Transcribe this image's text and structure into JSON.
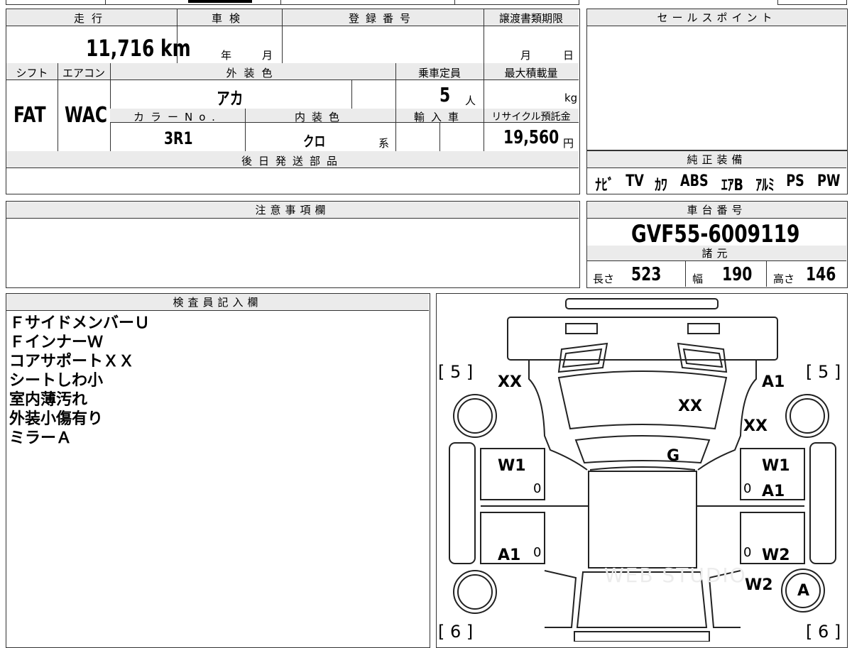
{
  "main_sheet": {
    "mileage_label": "走行",
    "mileage_value": "11,716 km",
    "shaken_label": "車検",
    "shaken_year": "年",
    "shaken_month": "月",
    "reg_label": "登録番号",
    "transfer_label": "譲渡書類期限",
    "transfer_month": "月",
    "transfer_day": "日",
    "shift_label": "シフト",
    "shift_value": "FAT",
    "aircon_label": "エアコン",
    "aircon_value": "WAC",
    "exterior_label": "外装色",
    "exterior_value": "アカ",
    "capacity_label": "乗車定員",
    "capacity_value": "5",
    "capacity_unit": "人",
    "load_label": "最大積載量",
    "load_unit": "kg",
    "color_no_label": "カラーNo.",
    "color_no_value": "3R1",
    "interior_label": "内装色",
    "interior_value": "クロ",
    "interior_suffix": "系",
    "import_label": "輸入車",
    "recycle_label": "リサイクル預託金",
    "recycle_value": "19,560",
    "recycle_unit": "円",
    "later_parts_label": "後日発送部品",
    "caution_label": "注意事項欄",
    "inspector_label": "検査員記入欄"
  },
  "sales_point": {
    "label": "セールスポイント"
  },
  "equipment": {
    "label": "純正装備",
    "items": [
      "ﾅﾋﾞ",
      "TV",
      "ｶﾜ",
      "ABS",
      "ｴｱB",
      "ｱﾙﾐ",
      "PS",
      "PW"
    ]
  },
  "chassis": {
    "label": "車台番号",
    "value": "GVF55-6009119"
  },
  "specs": {
    "label": "諸元",
    "length_label": "長さ",
    "length_value": "523",
    "width_label": "幅",
    "width_value": "190",
    "height_label": "高さ",
    "height_value": "146"
  },
  "inspector_notes": [
    "ＦサイドメンバーＵ",
    "ＦインナーＷ",
    "コアサポートＸＸ",
    "シートしわ小",
    "室内薄汚れ",
    "外装小傷有り",
    "ミラーＡ"
  ],
  "diagram": {
    "tire_fl": "5",
    "tire_fr": "5",
    "tire_rl": "6",
    "tire_rr": "6",
    "marks": {
      "front_left": "XX",
      "front_right": "A1",
      "hood": "XX",
      "fender_right": "XX",
      "windshield": "G",
      "front_door_left": "W1",
      "front_door_right": "W1",
      "front_door_right_2": "A1",
      "rear_door_left": "A1",
      "rear_door_right": "W2",
      "rear_quarter_right": "W2",
      "wheel_rear_right": "A",
      "zero": "0"
    },
    "watermark": "WEB STUDIO"
  }
}
